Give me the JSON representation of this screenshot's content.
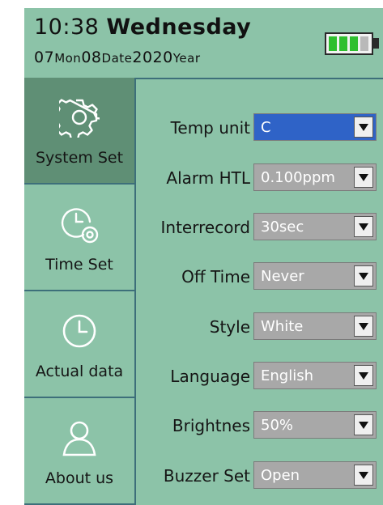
{
  "header": {
    "time": "10:38",
    "weekday": "Wednesday",
    "month": "07",
    "month_unit": "Mon",
    "day": "08",
    "day_unit": "Date",
    "year": "2020",
    "year_unit": "Year",
    "battery_level": 0.67
  },
  "sidebar": {
    "items": [
      {
        "label": "System Set",
        "icon": "gear-icon",
        "active": true
      },
      {
        "label": "Time Set",
        "icon": "clock-gear-icon",
        "active": false
      },
      {
        "label": "Actual data",
        "icon": "clock-icon",
        "active": false
      },
      {
        "label": "About us",
        "icon": "user-icon",
        "active": false
      }
    ]
  },
  "settings": [
    {
      "label": "Temp unit",
      "value": "C",
      "active": true
    },
    {
      "label": "Alarm HTL",
      "value": "0.100ppm",
      "active": false
    },
    {
      "label": "Interrecord",
      "value": "30sec",
      "active": false
    },
    {
      "label": "Off Time",
      "value": "Never",
      "active": false
    },
    {
      "label": "Style",
      "value": "White",
      "active": false
    },
    {
      "label": "Language",
      "value": "English",
      "active": false
    },
    {
      "label": "Brightnes",
      "value": "50%",
      "active": false
    },
    {
      "label": "Buzzer Set",
      "value": "Open",
      "active": false
    }
  ],
  "colors": {
    "background": "#8cc3a8",
    "active_nav": "#5f8f75",
    "active_select": "#2f63c7",
    "select": "#a8a8a8",
    "divider": "#3d6f7a"
  }
}
